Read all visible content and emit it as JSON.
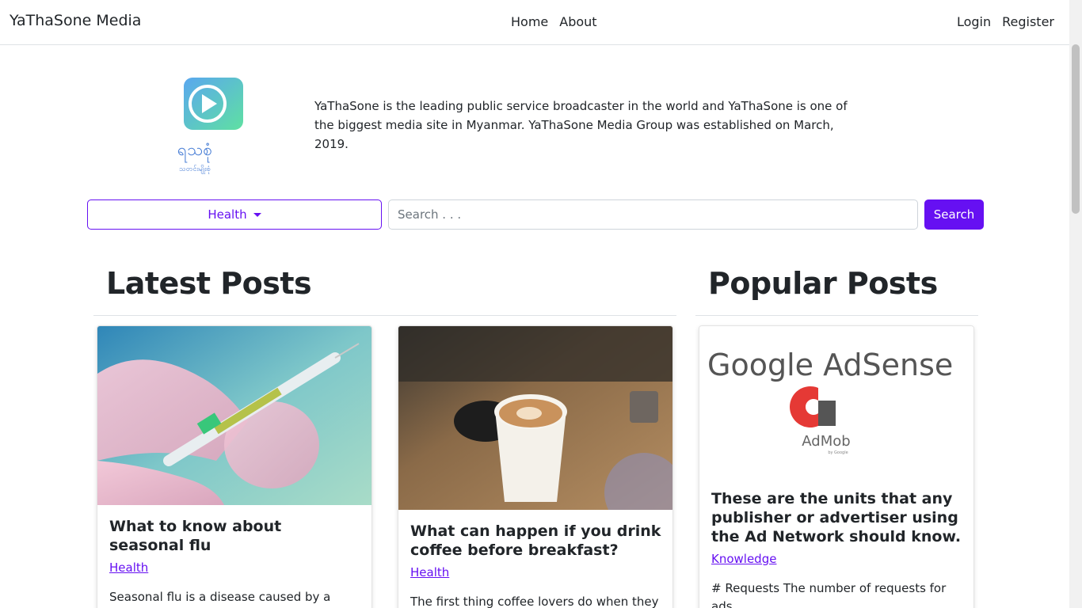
{
  "navbar": {
    "brand": "YaThaSone Media",
    "center_links": [
      "Home",
      "About"
    ],
    "right_links": [
      "Login",
      "Register"
    ]
  },
  "hero": {
    "logo_text": "ရသစုံ",
    "logo_subtext": "သတင်းမျိုးစုံ",
    "intro": "YaThaSone is the leading public service broadcaster in the world and YaThaSone is one of the biggest media site in Myanmar. YaThaSone Media Group was established on March, 2019."
  },
  "search": {
    "category_selected": "Health",
    "placeholder": "Search . . .",
    "button_label": "Search"
  },
  "latest": {
    "heading": "Latest Posts",
    "posts": [
      {
        "title": "What to know about seasonal flu",
        "category": "Health",
        "excerpt": "Seasonal flu is a disease caused by a virus that is spreading in many parts ..."
      },
      {
        "title": "What can happen if you drink coffee before breakfast?",
        "category": "Health",
        "excerpt": "The first thing coffee lovers do when they"
      }
    ]
  },
  "popular": {
    "heading": "Popular Posts",
    "posts": [
      {
        "image_text_1": "Google AdSense",
        "image_text_2": "AdMob",
        "image_text_3": "by Google",
        "title": "These are the units that any publisher or advertiser using the Ad Network should know.",
        "category": "Knowledge",
        "excerpt": "# Requests The number of requests for ads"
      }
    ]
  },
  "colors": {
    "accent": "#6610f2",
    "logo_gradient_start": "#5aa7ef",
    "logo_gradient_end": "#5fe0a2",
    "logo_text": "#4a7fd6"
  }
}
